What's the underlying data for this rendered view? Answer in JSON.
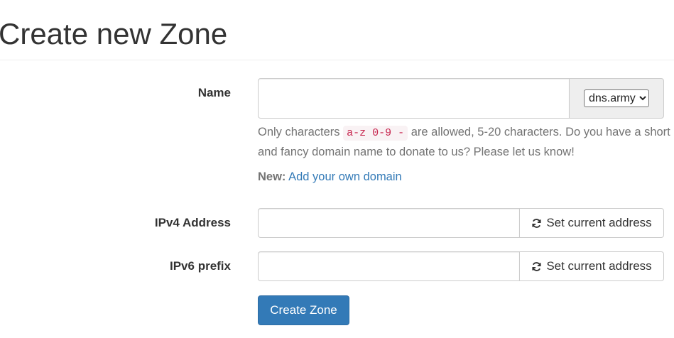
{
  "page": {
    "title": "Create new Zone"
  },
  "form": {
    "name": {
      "label": "Name",
      "value": "",
      "placeholder": "",
      "domain_selected": "dns.army"
    },
    "help": {
      "prefix": "Only characters ",
      "allowed_chars": "a-z 0-9 -",
      "suffix": " are allowed, 5-20 characters. Do you have a short and fancy domain name to donate to us? Please let us know!"
    },
    "new_notice": {
      "label": "New:",
      "link_text": "Add your own domain"
    },
    "ipv4": {
      "label": "IPv4 Address",
      "value": "",
      "button_label": "Set current address",
      "button_icon": "refresh-icon"
    },
    "ipv6": {
      "label": "IPv6 prefix",
      "value": "",
      "button_label": "Set current address",
      "button_icon": "refresh-icon"
    },
    "submit_label": "Create Zone"
  },
  "colors": {
    "primary": "#337ab7",
    "code_text": "#c7254e",
    "code_bg": "#f9f2f4",
    "help_text": "#737373",
    "link": "#337ab7"
  }
}
